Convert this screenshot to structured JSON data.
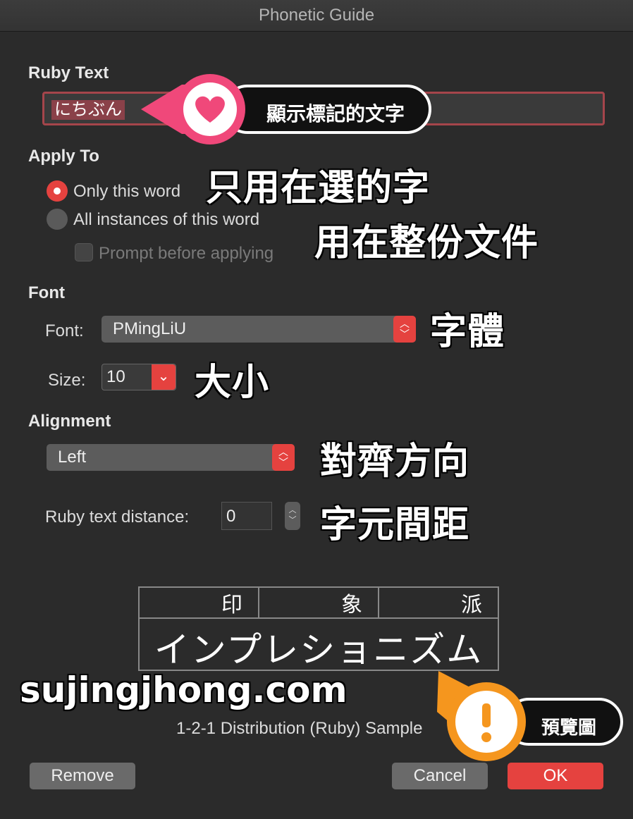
{
  "window": {
    "title": "Phonetic Guide"
  },
  "ruby_text": {
    "heading": "Ruby Text",
    "value": "にちぶん",
    "callout": "顯示標記的文字",
    "heart_icon": "heart-icon"
  },
  "apply_to": {
    "heading": "Apply To",
    "options": [
      {
        "label": "Only this word",
        "selected": true,
        "annotation": "只用在選的字"
      },
      {
        "label": "All instances of this word",
        "selected": false,
        "annotation": "用在整份文件"
      }
    ],
    "prompt_label": "Prompt before applying"
  },
  "font": {
    "heading": "Font",
    "font_label": "Font:",
    "font_value": "PMingLiU",
    "font_annotation": "字體",
    "size_label": "Size:",
    "size_value": "10",
    "size_annotation": "大小"
  },
  "alignment": {
    "heading": "Alignment",
    "value": "Left",
    "annotation": "對齊方向",
    "distance_label": "Ruby text distance:",
    "distance_value": "0",
    "distance_annotation": "字元間距"
  },
  "preview": {
    "ruby_chars": [
      "印",
      "象",
      "派"
    ],
    "base_text": "インプレショニズム",
    "caption": "1-2-1 Distribution (Ruby) Sample",
    "callout": "預覽圖",
    "warning_icon": "exclamation-icon"
  },
  "watermark": "sujingjhong.com",
  "buttons": {
    "remove": "Remove",
    "cancel": "Cancel",
    "ok": "OK"
  },
  "colors": {
    "accent": "#e5423f",
    "callout_pink": "#f0487a",
    "callout_orange": "#f5961e",
    "background": "#2b2b2b"
  }
}
